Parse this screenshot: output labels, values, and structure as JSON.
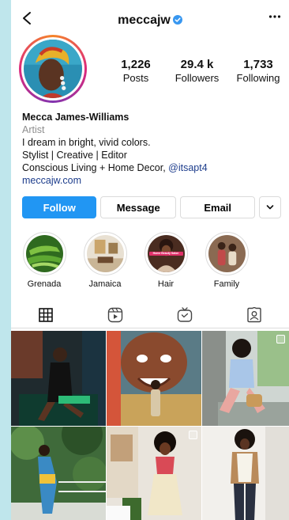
{
  "header": {
    "username": "meccajw"
  },
  "stats": [
    {
      "value": "1,226",
      "label": "Posts"
    },
    {
      "value": "29.4 k",
      "label": "Followers"
    },
    {
      "value": "1,733",
      "label": "Following"
    }
  ],
  "bio": {
    "name": "Mecca James-Williams",
    "category": "Artist",
    "line1": "I dream in bright, vivid colors.",
    "line2": "Stylist | Creative | Editor",
    "line3_text": "Conscious Living + Home Decor, ",
    "line3_mention": "@itsapt4",
    "website": "meccajw.com"
  },
  "actions": {
    "follow": "Follow",
    "message": "Message",
    "email": "Email"
  },
  "highlights": [
    {
      "label": "Grenada"
    },
    {
      "label": "Jamaica"
    },
    {
      "label": "Hair",
      "badge_text": "Home Beauty Salon"
    },
    {
      "label": "Family"
    }
  ],
  "colors": {
    "follow_button": "#2196f3",
    "verified": "#3897f0",
    "link": "#1d3d8c",
    "background": "#bfe6ec"
  }
}
